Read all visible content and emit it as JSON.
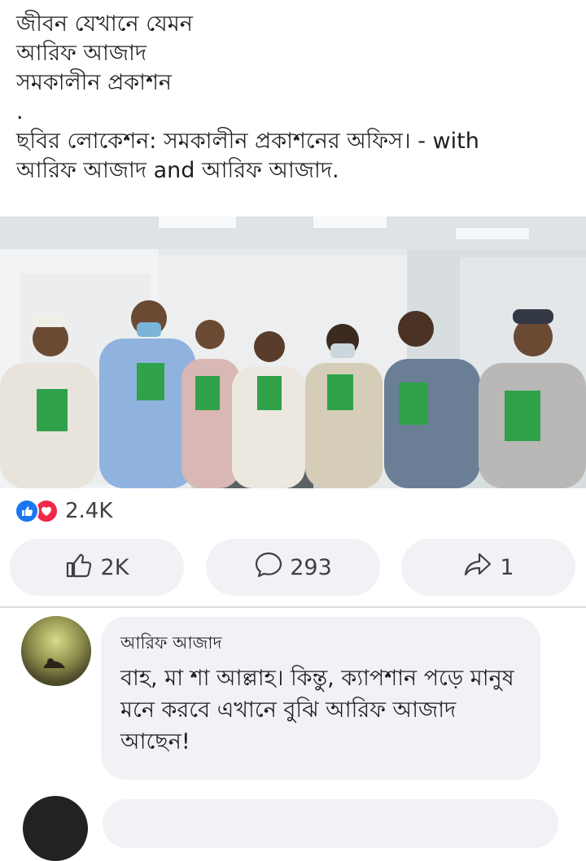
{
  "post": {
    "line1": "জীবন যেখানে যেমন",
    "line2": "আরিফ আজাদ",
    "line3": "সমকালীন প্রকাশন",
    "dot": ".",
    "location_line1": "ছবির লোকেশন: সমকালীন প্রকাশনের অফিস। - with",
    "location_line2": "আরিফ আজাদ and আরিফ আজাদ."
  },
  "reactions": {
    "types": [
      "like",
      "love"
    ],
    "count": "2.4K"
  },
  "actions": {
    "like_count": "2K",
    "comment_count": "293",
    "share_count": "1"
  },
  "comment": {
    "author": "আরিফ আজাদ",
    "text": "বাহ, মা শা আল্লাহ। কিন্তু, ক্যাপশান পড়ে মানুষ মনে করবে এখানে বুঝি আরিফ আজাদ আছেন!"
  },
  "colors": {
    "like_blue": "#1877f2",
    "love_red": "#f02849",
    "button_bg": "#f0f2f5",
    "book_green": "#2fa24a"
  },
  "icons": {
    "like_button": "thumbs-up-outline-icon",
    "comment_button": "speech-bubble-icon",
    "share_button": "share-arrow-icon"
  }
}
